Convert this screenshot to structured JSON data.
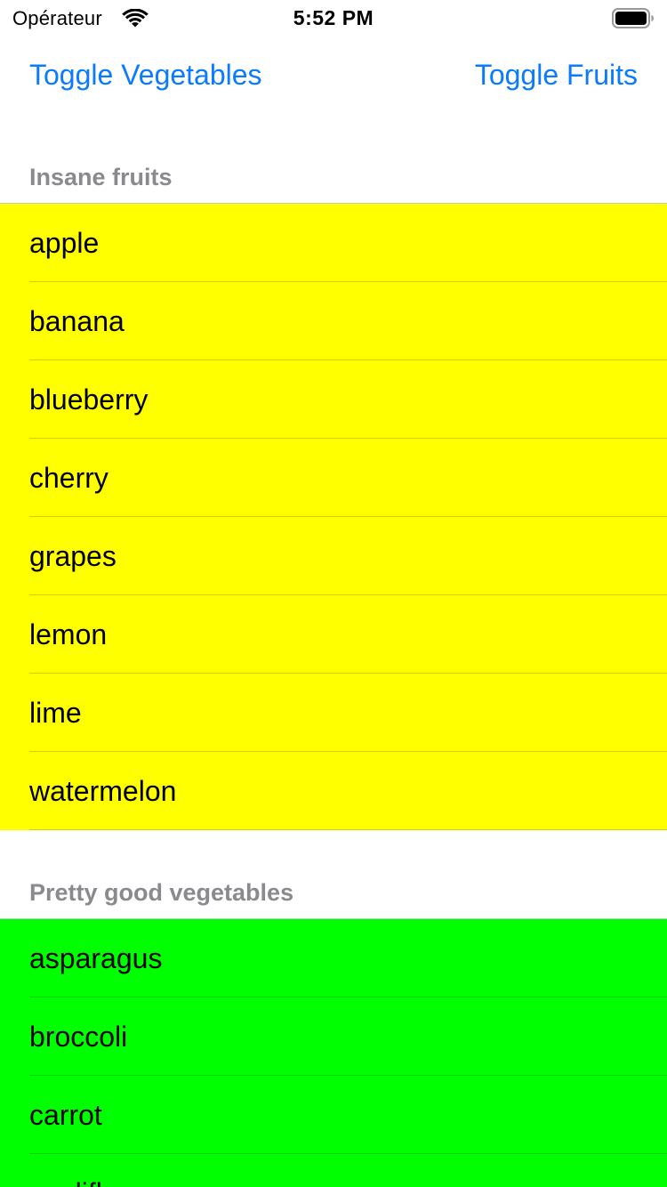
{
  "status_bar": {
    "carrier": "Opérateur",
    "time": "5:52 PM",
    "wifi_icon": "wifi-icon",
    "battery_icon": "battery-icon"
  },
  "toolbar": {
    "toggle_vegetables_label": "Toggle Vegetables",
    "toggle_fruits_label": "Toggle Fruits",
    "accent_color": "#0a7aff"
  },
  "sections": [
    {
      "header": "Insane fruits",
      "background_color": "#ffff00",
      "items": [
        "apple",
        "banana",
        "blueberry",
        "cherry",
        "grapes",
        "lemon",
        "lime",
        "watermelon"
      ]
    },
    {
      "header": "Pretty good vegetables",
      "background_color": "#00ff00",
      "items": [
        "asparagus",
        "broccoli",
        "carrot",
        "cauliflower"
      ]
    }
  ]
}
